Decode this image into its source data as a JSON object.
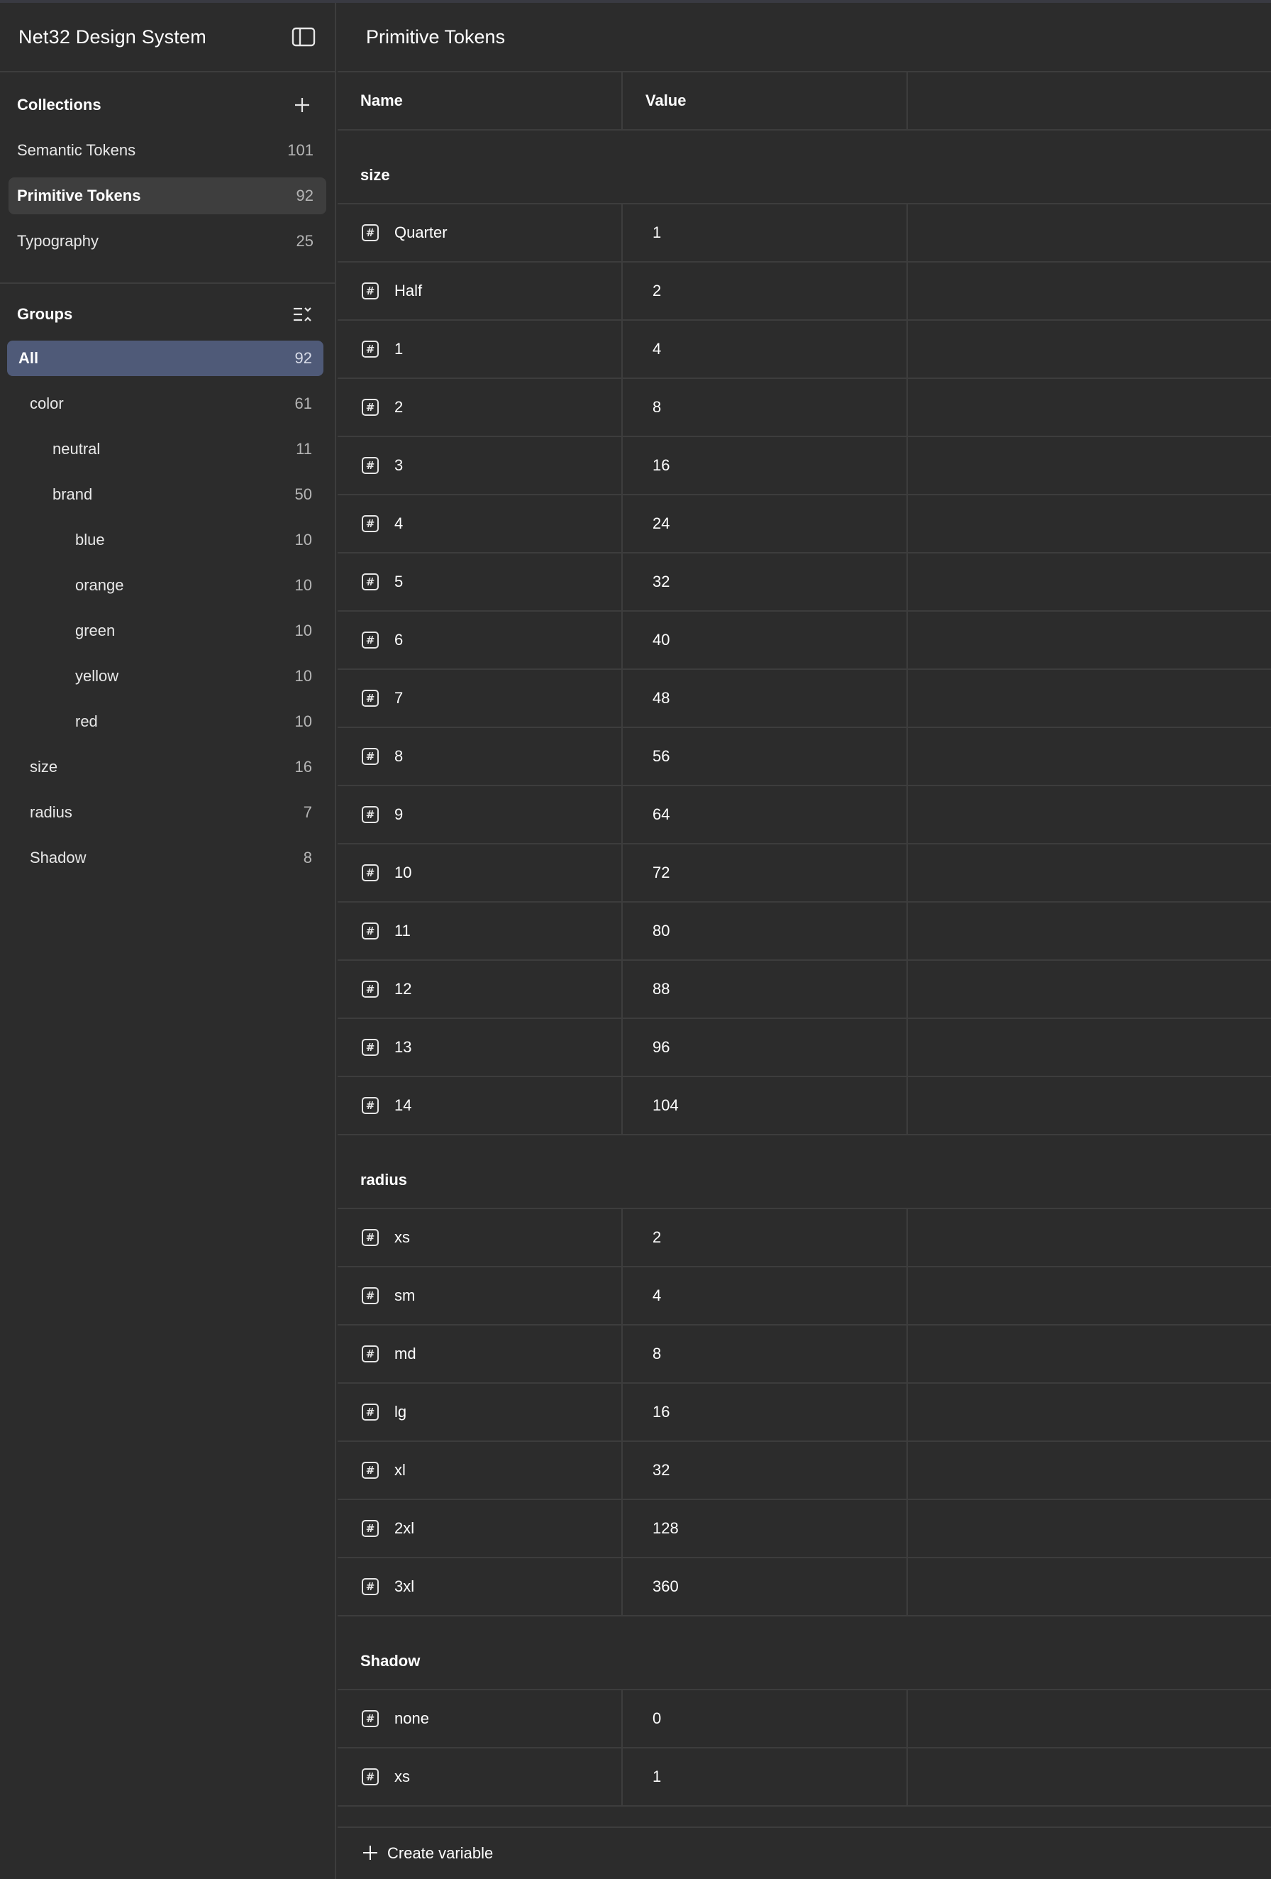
{
  "app": {
    "title": "Net32 Design System"
  },
  "sidebar": {
    "collections_title": "Collections",
    "collections": [
      {
        "label": "Semantic Tokens",
        "count": "101"
      },
      {
        "label": "Primitive Tokens",
        "count": "92",
        "active": true
      },
      {
        "label": "Typography",
        "count": "25"
      }
    ],
    "groups_title": "Groups",
    "groups": [
      {
        "label": "All",
        "count": "92",
        "level": 0,
        "active": true
      },
      {
        "label": "color",
        "count": "61",
        "level": 1
      },
      {
        "label": "neutral",
        "count": "11",
        "level": 2
      },
      {
        "label": "brand",
        "count": "50",
        "level": 2
      },
      {
        "label": "blue",
        "count": "10",
        "level": 3
      },
      {
        "label": "orange",
        "count": "10",
        "level": 3
      },
      {
        "label": "green",
        "count": "10",
        "level": 3
      },
      {
        "label": "yellow",
        "count": "10",
        "level": 3
      },
      {
        "label": "red",
        "count": "10",
        "level": 3
      },
      {
        "label": "size",
        "count": "16",
        "level": 1
      },
      {
        "label": "radius",
        "count": "7",
        "level": 1
      },
      {
        "label": "Shadow",
        "count": "8",
        "level": 1
      }
    ]
  },
  "main": {
    "title": "Primitive Tokens",
    "columns": {
      "name": "Name",
      "value": "Value"
    },
    "groups": [
      {
        "label": "size",
        "rows": [
          {
            "name": "Quarter",
            "value": "1"
          },
          {
            "name": "Half",
            "value": "2"
          },
          {
            "name": "1",
            "value": "4"
          },
          {
            "name": "2",
            "value": "8"
          },
          {
            "name": "3",
            "value": "16"
          },
          {
            "name": "4",
            "value": "24"
          },
          {
            "name": "5",
            "value": "32"
          },
          {
            "name": "6",
            "value": "40"
          },
          {
            "name": "7",
            "value": "48"
          },
          {
            "name": "8",
            "value": "56"
          },
          {
            "name": "9",
            "value": "64"
          },
          {
            "name": "10",
            "value": "72"
          },
          {
            "name": "11",
            "value": "80"
          },
          {
            "name": "12",
            "value": "88"
          },
          {
            "name": "13",
            "value": "96"
          },
          {
            "name": "14",
            "value": "104"
          }
        ]
      },
      {
        "label": "radius",
        "rows": [
          {
            "name": "xs",
            "value": "2"
          },
          {
            "name": "sm",
            "value": "4"
          },
          {
            "name": "md",
            "value": "8"
          },
          {
            "name": "lg",
            "value": "16"
          },
          {
            "name": "xl",
            "value": "32"
          },
          {
            "name": "2xl",
            "value": "128"
          },
          {
            "name": "3xl",
            "value": "360"
          }
        ]
      },
      {
        "label": "Shadow",
        "rows": [
          {
            "name": "none",
            "value": "0"
          },
          {
            "name": "xs",
            "value": "1"
          }
        ]
      }
    ],
    "create_label": "Create variable"
  },
  "icons": {
    "sidebar_toggle": "sidebar-toggle-icon",
    "add": "plus-icon",
    "collapse": "collapse-list-icon",
    "variable": "number-variable-icon"
  },
  "colors": {
    "background": "#2c2c2c",
    "divider": "#3d3d3d",
    "selected_collection": "#3e3e3e",
    "selected_group": "#4f5a78"
  }
}
